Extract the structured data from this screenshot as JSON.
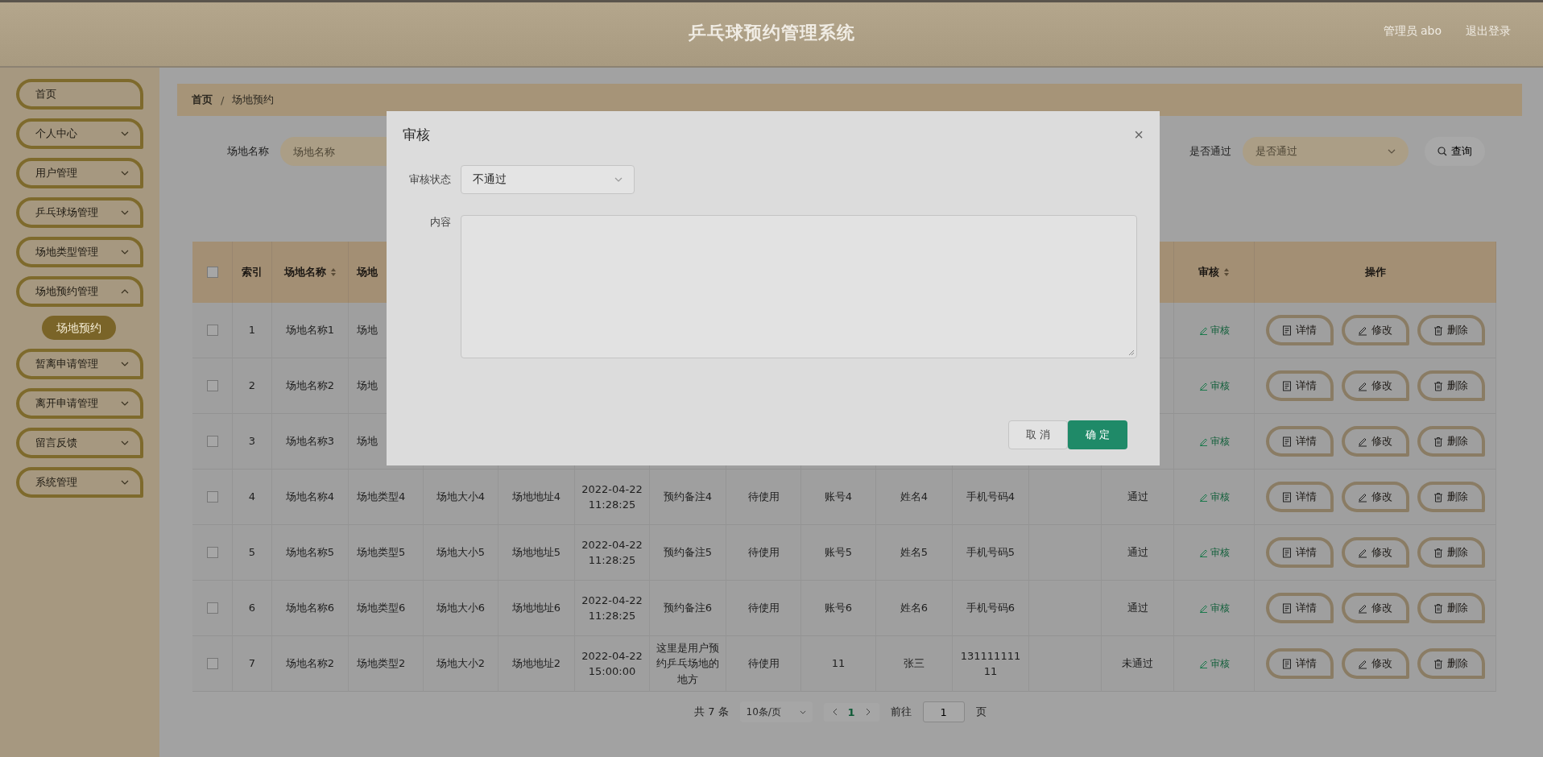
{
  "header": {
    "title": "乒乓球预约管理系统",
    "user": "管理员 abo",
    "logout": "退出登录"
  },
  "sidebar": {
    "items": [
      {
        "label": "首页"
      },
      {
        "label": "个人中心",
        "expanded": false
      },
      {
        "label": "用户管理",
        "expanded": false
      },
      {
        "label": "乒乓球场管理",
        "expanded": false
      },
      {
        "label": "场地类型管理",
        "expanded": false
      },
      {
        "label": "场地预约管理",
        "expanded": true,
        "children": [
          {
            "label": "场地预约",
            "selected": true
          }
        ]
      },
      {
        "label": "暂离申请管理",
        "expanded": false
      },
      {
        "label": "离开申请管理",
        "expanded": false
      },
      {
        "label": "留言反馈",
        "expanded": false
      },
      {
        "label": "系统管理",
        "expanded": false
      }
    ]
  },
  "breadcrumb": {
    "items": [
      "首页",
      "场地预约"
    ],
    "separator": "/"
  },
  "search": {
    "fields": [
      {
        "label": "场地名称",
        "placeholder": "场地名称",
        "kind": "input"
      },
      {
        "label": "是否通过",
        "placeholder": "是否通过",
        "kind": "select"
      }
    ],
    "button": "查询"
  },
  "table": {
    "all_checked": false,
    "columns": [
      {
        "label": "索引",
        "sortable": false
      },
      {
        "label": "场地名称",
        "sortable": true
      },
      {
        "label": "场地",
        "sortable": false
      },
      null,
      null,
      null,
      null,
      null,
      null,
      null,
      null,
      null,
      null,
      {
        "label": "审核",
        "sortable": true
      },
      {
        "label": "操作",
        "sortable": false
      }
    ],
    "rows": [
      {
        "checked": false,
        "cells": [
          "1",
          "场地名称1",
          "场地",
          null,
          null,
          null,
          null,
          null,
          null,
          null,
          null,
          null,
          null
        ],
        "review": "审核",
        "actions": [
          {
            "label": "详情",
            "kind": "detail"
          },
          {
            "label": "修改",
            "kind": "edit"
          },
          {
            "label": "删除",
            "kind": "delete"
          }
        ]
      },
      {
        "checked": false,
        "cells": [
          "2",
          "场地名称2",
          "场地",
          null,
          null,
          null,
          null,
          null,
          null,
          null,
          null,
          null,
          null
        ],
        "review": "审核",
        "actions": [
          {
            "label": "详情",
            "kind": "detail"
          },
          {
            "label": "修改",
            "kind": "edit"
          },
          {
            "label": "删除",
            "kind": "delete"
          }
        ]
      },
      {
        "checked": false,
        "cells": [
          "3",
          "场地名称3",
          "场地",
          null,
          null,
          null,
          null,
          null,
          null,
          null,
          null,
          null,
          null
        ],
        "review": "审核",
        "actions": [
          {
            "label": "详情",
            "kind": "detail"
          },
          {
            "label": "修改",
            "kind": "edit"
          },
          {
            "label": "删除",
            "kind": "delete"
          }
        ]
      },
      {
        "checked": false,
        "cells": [
          "4",
          "场地名称4",
          "场地类型4",
          "场地大小4",
          "场地地址4",
          "2022-04-22 11:28:25",
          "预约备注4",
          "待使用",
          "账号4",
          "姓名4",
          "手机号码4",
          null,
          "通过"
        ],
        "review": "审核",
        "actions": [
          {
            "label": "详情",
            "kind": "detail"
          },
          {
            "label": "修改",
            "kind": "edit"
          },
          {
            "label": "删除",
            "kind": "delete"
          }
        ]
      },
      {
        "checked": false,
        "cells": [
          "5",
          "场地名称5",
          "场地类型5",
          "场地大小5",
          "场地地址5",
          "2022-04-22 11:28:25",
          "预约备注5",
          "待使用",
          "账号5",
          "姓名5",
          "手机号码5",
          null,
          "通过"
        ],
        "review": "审核",
        "actions": [
          {
            "label": "详情",
            "kind": "detail"
          },
          {
            "label": "修改",
            "kind": "edit"
          },
          {
            "label": "删除",
            "kind": "delete"
          }
        ]
      },
      {
        "checked": false,
        "cells": [
          "6",
          "场地名称6",
          "场地类型6",
          "场地大小6",
          "场地地址6",
          "2022-04-22 11:28:25",
          "预约备注6",
          "待使用",
          "账号6",
          "姓名6",
          "手机号码6",
          null,
          "通过"
        ],
        "review": "审核",
        "actions": [
          {
            "label": "详情",
            "kind": "detail"
          },
          {
            "label": "修改",
            "kind": "edit"
          },
          {
            "label": "删除",
            "kind": "delete"
          }
        ]
      },
      {
        "checked": false,
        "cells": [
          "7",
          "场地名称2",
          "场地类型2",
          "场地大小2",
          "场地地址2",
          "2022-04-22 15:00:00",
          "这里是用户预约乒乓场地的地方",
          "待使用",
          "11",
          "张三",
          "13111111111",
          null,
          "未通过"
        ],
        "review": "审核",
        "actions": [
          {
            "label": "详情",
            "kind": "detail"
          },
          {
            "label": "修改",
            "kind": "edit"
          },
          {
            "label": "删除",
            "kind": "delete"
          }
        ]
      }
    ]
  },
  "pagination": {
    "total": "共 7 条",
    "page_size": "10条/页",
    "pages": [
      {
        "label": "1",
        "selected": true
      }
    ],
    "goto_label": "前往",
    "goto_value": "1",
    "goto_suffix": "页"
  },
  "dialog": {
    "title": "审核",
    "close": "×",
    "status_label": "审核状态",
    "status_value": "不通过",
    "content_label": "内容",
    "cancel": "取 消",
    "confirm": "确 定"
  }
}
